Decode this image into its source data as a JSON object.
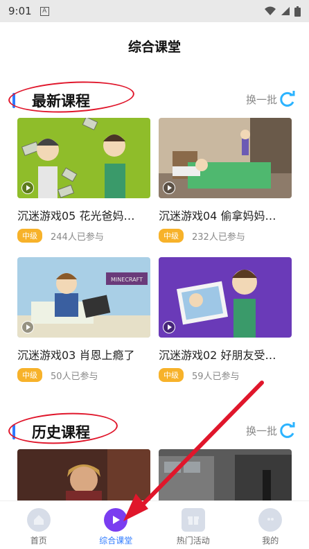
{
  "status": {
    "time": "9:01",
    "notif_icon": "A"
  },
  "header": {
    "title": "综合课堂"
  },
  "sections": {
    "latest": {
      "title": "最新课程",
      "refresh_label": "换一批"
    },
    "history": {
      "title": "历史课程",
      "refresh_label": "换一批"
    }
  },
  "courses": [
    {
      "title": "沉迷游戏05 花光爸妈…",
      "level": "中级",
      "participants": "244人已参与"
    },
    {
      "title": "沉迷游戏04 偷拿妈妈…",
      "level": "中级",
      "participants": "232人已参与"
    },
    {
      "title": "沉迷游戏03 肖恩上瘾了",
      "level": "中级",
      "participants": "50人已参与"
    },
    {
      "title": "沉迷游戏02 好朋友受…",
      "level": "中级",
      "participants": "59人已参与"
    }
  ],
  "thumb_texts": {
    "minecraft_sign": "MINECRAFT"
  },
  "tabs": [
    {
      "label": "首页",
      "icon": "home-icon",
      "active": false
    },
    {
      "label": "综合课堂",
      "icon": "play-icon",
      "active": true
    },
    {
      "label": "热门活动",
      "icon": "gift-icon",
      "active": false
    },
    {
      "label": "我的",
      "icon": "profile-icon",
      "active": false
    }
  ],
  "colors": {
    "accent_blue": "#2f7bff",
    "badge_orange": "#f7b22a",
    "active_purple": "#7a3df0",
    "annotation_red": "#e0162b"
  }
}
